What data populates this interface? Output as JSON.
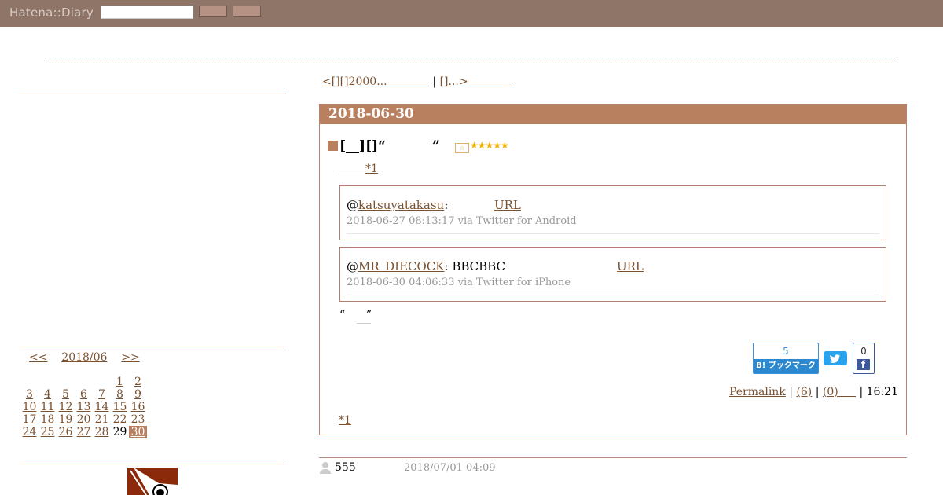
{
  "header": {
    "brand": "Hatena::Diary",
    "search_value": "",
    "colors": {
      "bar": "#8f7567",
      "accent": "#b98060"
    }
  },
  "pager": {
    "prev": "<[][]2000...            ",
    "sep": " | ",
    "next": "[]...>            "
  },
  "entry": {
    "date": "2018-06-30",
    "title": "[__][]“          ”",
    "stars_icon": "star-icon",
    "stars": "★★★★★",
    "footnote_ref": "*1",
    "tweets": [
      {
        "prefix": "@",
        "user": "katsuyatakasu",
        "text": ":                ",
        "url_label": "URL",
        "meta": "2018-06-27 08:13:17 via Twitter for Android"
      },
      {
        "prefix": "@",
        "user": "MR_DIECOCK",
        "text": ": BBCBBC",
        "url_label": "URL",
        "meta": "2018-06-30 04:06:33 via Twitter for iPhone"
      }
    ],
    "quote": "“      ”",
    "hatebu": {
      "count": "5",
      "label": "B! ブックマーク"
    },
    "facebook": {
      "count": "0",
      "logo": "f"
    },
    "footer": {
      "permalink": "Permalink",
      "comments": "(6)",
      "trackbacks": "(0)",
      "time": "16:21"
    },
    "footnote": "*1"
  },
  "comment": {
    "name": "555",
    "date": "2018/07/01 04:09"
  },
  "calendar": {
    "prev": "<<",
    "month": "2018/06",
    "next": ">>",
    "weeks": [
      [
        "",
        "",
        "",
        "",
        "",
        "1",
        "2"
      ],
      [
        "3",
        "4",
        "5",
        "6",
        "7",
        "8",
        "9"
      ],
      [
        "10",
        "11",
        "12",
        "13",
        "14",
        "15",
        "16"
      ],
      [
        "17",
        "18",
        "19",
        "20",
        "21",
        "22",
        "23"
      ],
      [
        "24",
        "25",
        "26",
        "27",
        "28",
        "29",
        "30"
      ]
    ],
    "no_link": [
      "29"
    ],
    "today": "30"
  }
}
